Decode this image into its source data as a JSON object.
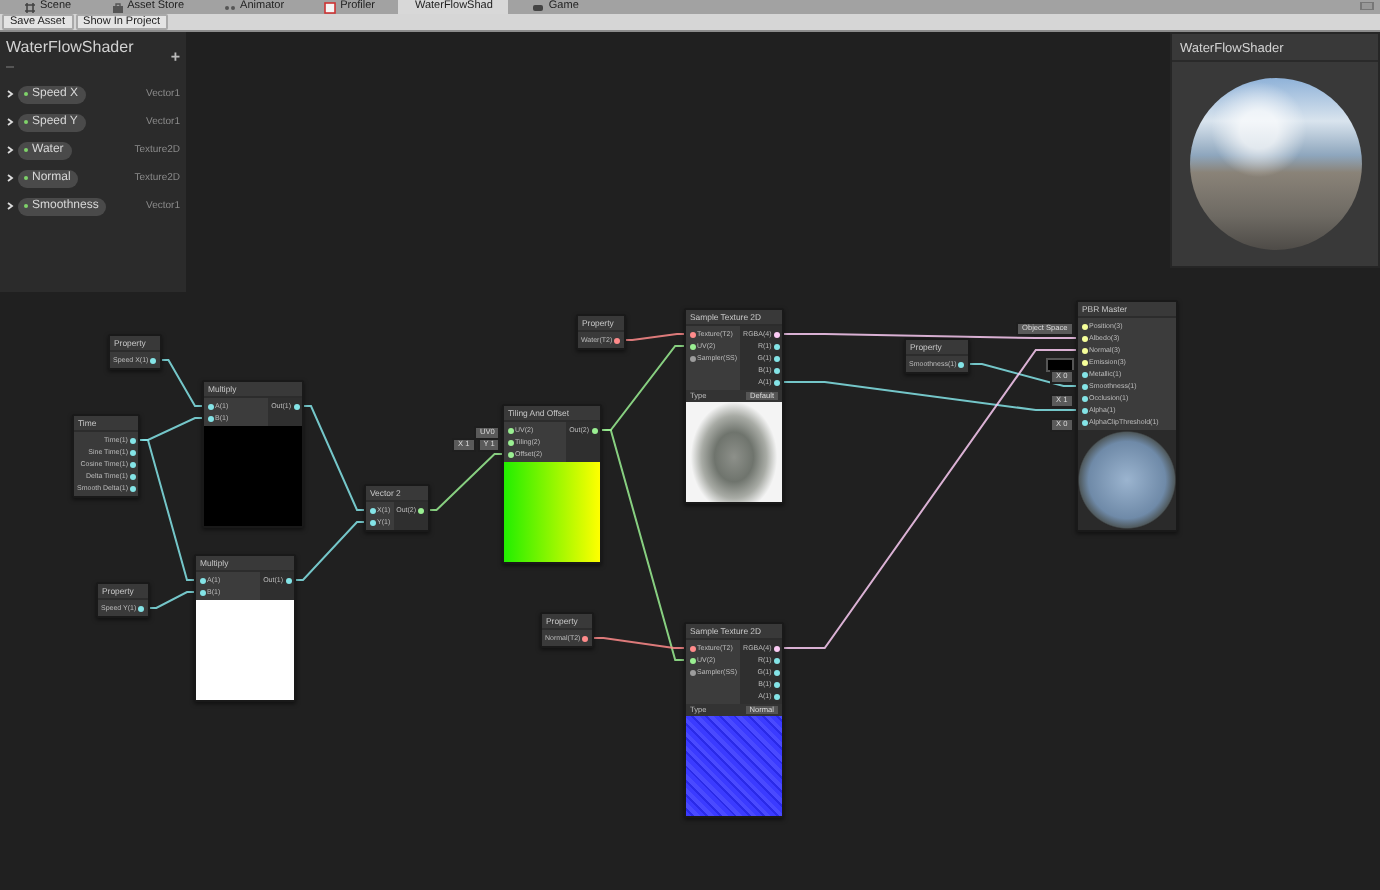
{
  "tabs": [
    {
      "label": "Scene",
      "selected": false
    },
    {
      "label": "Asset Store",
      "selected": false
    },
    {
      "label": "Animator",
      "selected": false
    },
    {
      "label": "Profiler",
      "selected": false
    },
    {
      "label": "WaterFlowShad",
      "selected": true
    },
    {
      "label": "Game",
      "selected": false
    }
  ],
  "toolbar": {
    "buttons": [
      "Save Asset",
      "Show In Project"
    ]
  },
  "blackboard": {
    "title": "WaterFlowShader",
    "add_button": "+",
    "properties": [
      {
        "name": "Speed X",
        "type": "Vector1",
        "expanded": false,
        "exposed": true
      },
      {
        "name": "Speed Y",
        "type": "Vector1",
        "expanded": false,
        "exposed": true
      },
      {
        "name": "Water",
        "type": "Texture2D",
        "expanded": false,
        "exposed": true
      },
      {
        "name": "Normal",
        "type": "Texture2D",
        "expanded": false,
        "exposed": true
      },
      {
        "name": "Smoothness",
        "type": "Vector1",
        "expanded": false,
        "exposed": true
      }
    ]
  },
  "preview_window": {
    "title": "WaterFlowShader"
  },
  "graph": {
    "nodes": [
      {
        "title": "Property",
        "outputs": [
          {
            "label": "Speed X(1)",
            "kind": "vector1"
          }
        ]
      },
      {
        "title": "Time",
        "outputs": [
          {
            "label": "Time(1)",
            "kind": "vector1"
          },
          {
            "label": "Sine Time(1)",
            "kind": "vector1"
          },
          {
            "label": "Cosine Time(1)",
            "kind": "vector1"
          },
          {
            "label": "Delta Time(1)",
            "kind": "vector1"
          },
          {
            "label": "Smooth Delta(1)",
            "kind": "vector1"
          }
        ]
      },
      {
        "title": "Multiply",
        "inputs": [
          {
            "label": "A(1)",
            "kind": "vector1"
          },
          {
            "label": "B(1)",
            "kind": "vector1"
          }
        ],
        "outputs": [
          {
            "label": "Out(1)",
            "kind": "vector1"
          }
        ],
        "preview": {
          "kind": "black"
        }
      },
      {
        "title": "Property",
        "outputs": [
          {
            "label": "Speed Y(1)",
            "kind": "vector1"
          }
        ]
      },
      {
        "title": "Multiply",
        "inputs": [
          {
            "label": "A(1)",
            "kind": "vector1"
          },
          {
            "label": "B(1)",
            "kind": "vector1"
          }
        ],
        "outputs": [
          {
            "label": "Out(1)",
            "kind": "vector1"
          }
        ],
        "preview": {
          "kind": "white"
        }
      },
      {
        "title": "Vector 2",
        "inputs": [
          {
            "label": "X(1)",
            "kind": "vector1"
          },
          {
            "label": "Y(1)",
            "kind": "vector1"
          }
        ],
        "outputs": [
          {
            "label": "Out(2)",
            "kind": "vector2"
          }
        ]
      },
      {
        "title": "Tiling And Offset",
        "inputs": [
          {
            "label": "UV(2)",
            "kind": "vector2",
            "field": {
              "kind": "text",
              "values": [
                "UV0"
              ]
            }
          },
          {
            "label": "Tiling(2)",
            "kind": "vector2",
            "field": {
              "kind": "text",
              "values": [
                "X 1",
                "Y 1"
              ]
            }
          },
          {
            "label": "Offset(2)",
            "kind": "vector2"
          }
        ],
        "outputs": [
          {
            "label": "Out(2)",
            "kind": "vector2"
          }
        ],
        "preview": {
          "kind": "gradient"
        }
      },
      {
        "title": "Property",
        "outputs": [
          {
            "label": "Water(T2)",
            "kind": "texture"
          }
        ]
      },
      {
        "title": "Sample Texture 2D",
        "inputs": [
          {
            "label": "Texture(T2)",
            "kind": "texture"
          },
          {
            "label": "UV(2)",
            "kind": "vector2"
          },
          {
            "label": "Sampler(SS)",
            "kind": "sampler"
          }
        ],
        "outputs": [
          {
            "label": "RGBA(4)",
            "kind": "vector4"
          },
          {
            "label": "R(1)",
            "kind": "vector1"
          },
          {
            "label": "G(1)",
            "kind": "vector1"
          },
          {
            "label": "B(1)",
            "kind": "vector1"
          },
          {
            "label": "A(1)",
            "kind": "vector1"
          }
        ],
        "type_row": {
          "label": "Type",
          "value": "Default"
        },
        "preview": {
          "kind": "photo"
        }
      },
      {
        "title": "Property",
        "outputs": [
          {
            "label": "Smoothness(1)",
            "kind": "vector1"
          }
        ]
      },
      {
        "title": "PBR Master",
        "inputs": [
          {
            "label": "Position(3)",
            "kind": "vector3",
            "field": {
              "kind": "text",
              "values": [
                "Object Space"
              ]
            }
          },
          {
            "label": "Albedo(3)",
            "kind": "vector3"
          },
          {
            "label": "Normal(3)",
            "kind": "vector3"
          },
          {
            "label": "Emission(3)",
            "kind": "vector3",
            "field": {
              "kind": "swatch"
            }
          },
          {
            "label": "Metallic(1)",
            "kind": "vector1",
            "field": {
              "kind": "text",
              "values": [
                "X 0"
              ]
            }
          },
          {
            "label": "Smoothness(1)",
            "kind": "vector1"
          },
          {
            "label": "Occlusion(1)",
            "kind": "vector1",
            "field": {
              "kind": "text",
              "values": [
                "X 1"
              ]
            }
          },
          {
            "label": "Alpha(1)",
            "kind": "vector1"
          },
          {
            "label": "AlphaClipThreshold(1)",
            "kind": "vector1",
            "field": {
              "kind": "text",
              "values": [
                "X 0"
              ]
            }
          }
        ],
        "preview": {
          "kind": "sphere"
        }
      },
      {
        "title": "Property",
        "outputs": [
          {
            "label": "Normal(T2)",
            "kind": "texture"
          }
        ]
      },
      {
        "title": "Sample Texture 2D",
        "inputs": [
          {
            "label": "Texture(T2)",
            "kind": "texture"
          },
          {
            "label": "UV(2)",
            "kind": "vector2"
          },
          {
            "label": "Sampler(SS)",
            "kind": "sampler"
          }
        ],
        "outputs": [
          {
            "label": "RGBA(4)",
            "kind": "vector4"
          },
          {
            "label": "R(1)",
            "kind": "vector1"
          },
          {
            "label": "G(1)",
            "kind": "vector1"
          },
          {
            "label": "B(1)",
            "kind": "vector1"
          },
          {
            "label": "A(1)",
            "kind": "vector1"
          }
        ],
        "type_row": {
          "label": "Type",
          "value": "Normal"
        },
        "preview": {
          "kind": "normal"
        }
      }
    ]
  }
}
